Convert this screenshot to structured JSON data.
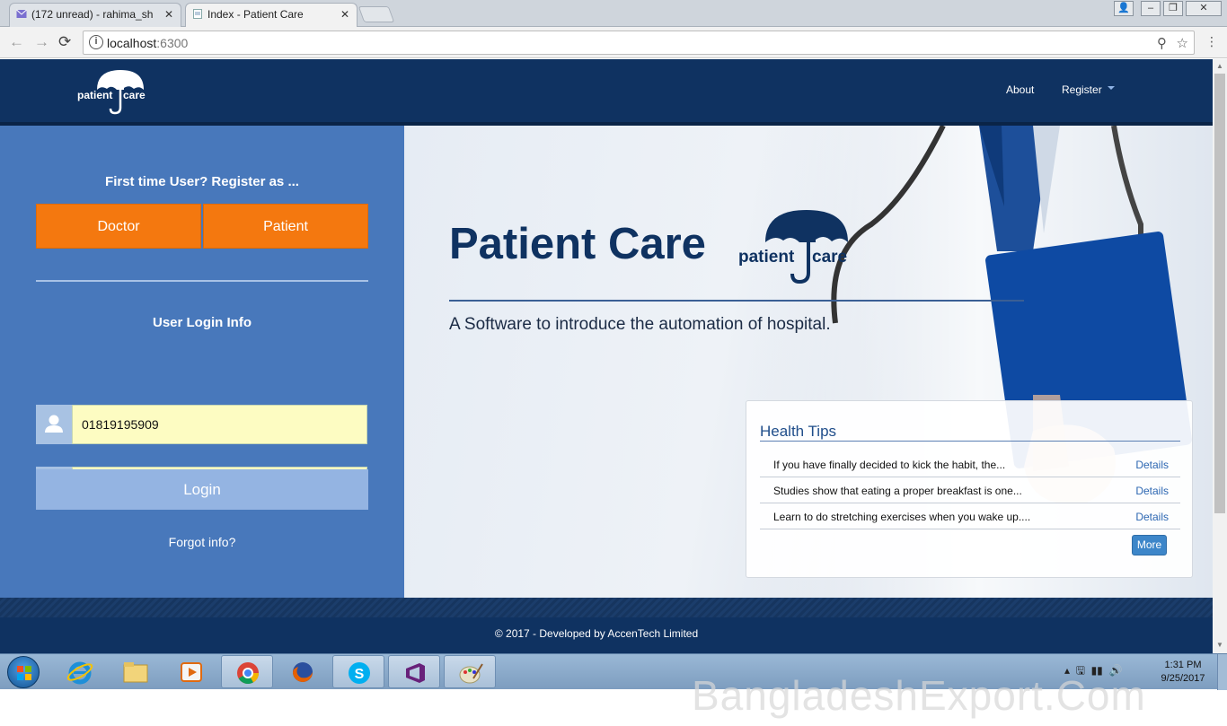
{
  "browser": {
    "tabs": [
      {
        "label": "(172 unread) - rahima_sh",
        "active": false,
        "icon": "mail-icon"
      },
      {
        "label": "Index - Patient Care",
        "active": true,
        "icon": "page-icon"
      }
    ],
    "url_host": "localhost",
    "url_port": ":6300"
  },
  "header": {
    "logo_text_left": "patient",
    "logo_text_right": "care",
    "nav_about": "About",
    "nav_register": "Register"
  },
  "left_panel": {
    "register_title": "First time User? Register as ...",
    "doctor_label": "Doctor",
    "patient_label": "Patient",
    "login_title": "User Login Info",
    "username_value": "01819195909",
    "password_value": "••••••••",
    "login_label": "Login",
    "forgot_label": "Forgot info?"
  },
  "hero": {
    "title": "Patient Care",
    "logo_text_left": "patient",
    "logo_text_right": "care",
    "subtitle": "A Software to introduce the automation of hospital."
  },
  "health_tips": {
    "title": "Health Tips",
    "items": [
      {
        "text": "If you have finally decided to kick the habit, the...",
        "link": "Details"
      },
      {
        "text": "Studies show that eating a proper breakfast is one...",
        "link": "Details"
      },
      {
        "text": "Learn to do stretching exercises when you wake up....",
        "link": "Details"
      }
    ],
    "more_label": "More"
  },
  "footer": {
    "text": "© 2017 - Developed by AccenTech Limited"
  },
  "taskbar": {
    "time": "1:31 PM",
    "date": "9/25/2017"
  },
  "watermark": "BangladeshExport.Com",
  "colors": {
    "navy": "#0f3261",
    "panel_blue": "#4878bb",
    "orange": "#f4780f",
    "input_yellow": "#fdfcc2"
  }
}
